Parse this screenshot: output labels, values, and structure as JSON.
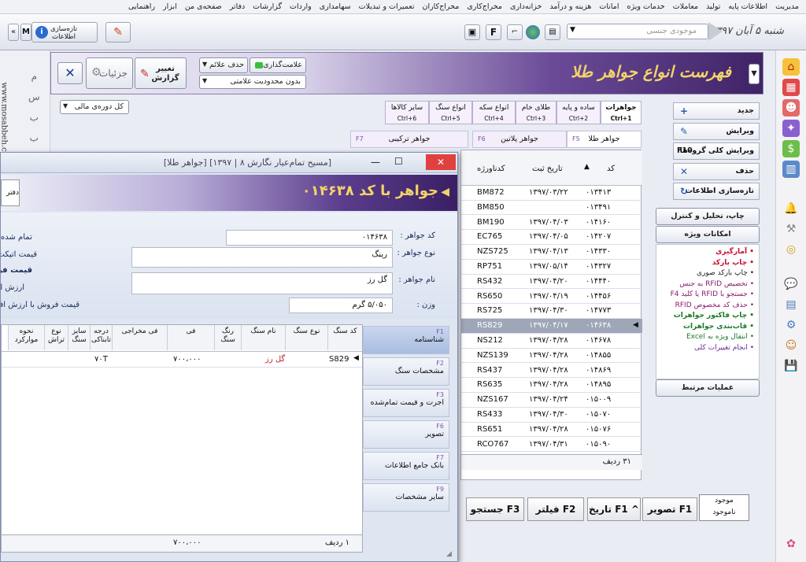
{
  "menubar": [
    "مدیریت",
    "اطلاعات پایه",
    "تولید",
    "معاملات",
    "خدمات ویژه",
    "امانات",
    "هزینه و درآمد",
    "خزانه‌داری",
    "مخراج‌کاری",
    "مخراج‌کاران",
    "تعمیرات و تبدیلات",
    "سهامداری",
    "واردات",
    "گزارشات",
    "دفاتر",
    "صفحه‌ی من",
    "ابزار",
    "راهنمایی"
  ],
  "toolbar": {
    "date": "شنبه ۵ آبان ۱۳۹۷",
    "gender_placeholder": "موجودی جنسی",
    "refresh_label": "تازه‌سازی اطلاعات",
    "m_label": "M"
  },
  "banner": {
    "title": "فهرست انواع جواهر طلا",
    "marking_label": "علامت‌گذاری",
    "remove_marks_label": "حذف علائم",
    "no_limit_label": "بدون محدودیت علامتی",
    "change_report_label": "تغییر گزارش",
    "details_label": "جزئیات"
  },
  "fiscal": "کل دوره‌ی مالی",
  "actions": [
    "جدید",
    "ویرایش",
    "ویرایش کلی گروه‌ها",
    "حذف",
    "تازه‌سازی اطلاعات"
  ],
  "actions_f10": "F10",
  "print_label": "چاپ، تحلیل و کنترل فهرست",
  "special_label": "امکانات ویژه",
  "options": [
    {
      "t": "آمارگیری",
      "c": "#c8102e",
      "b": true
    },
    {
      "t": "چاپ بارکد",
      "c": "#c8102e",
      "b": true
    },
    {
      "t": "چاپ بارکد صوری",
      "c": "#222",
      "b": false
    },
    {
      "t": "تخصیص RFID به جنس",
      "c": "#8b1a6b",
      "b": false
    },
    {
      "t": "جستجو با RFID یا کلید F4",
      "c": "#8b1a6b",
      "b": false
    },
    {
      "t": "حذف کد مخصوص RFID",
      "c": "#8b1a6b",
      "b": false
    },
    {
      "t": "چاپ فاکتور جواهرات",
      "c": "#1a7a2a",
      "b": true
    },
    {
      "t": "قاب‌بندی جواهرات",
      "c": "#1a7a2a",
      "b": true
    },
    {
      "t": "انتقال ویژه به Excel",
      "c": "#1a7a2a",
      "b": false
    },
    {
      "t": "انجام تغییرات کلی",
      "c": "#6a2a9a",
      "b": false
    }
  ],
  "related_label": "عملیات مرتبط",
  "tabs1": [
    {
      "label": "جواهرات",
      "key": "Ctrl+1"
    },
    {
      "label": "ساده و پایه",
      "key": "Ctrl+2"
    },
    {
      "label": "طلای خام",
      "key": "Ctrl+3"
    },
    {
      "label": "انواع سکه",
      "key": "Ctrl+4"
    },
    {
      "label": "انواع سنگ",
      "key": "Ctrl+5"
    },
    {
      "label": "سایر کالاها",
      "key": "Ctrl+6"
    }
  ],
  "tabs2": [
    {
      "label": "جواهر طلا",
      "key": "F5"
    },
    {
      "label": "جواهر پلاتین",
      "key": "F6"
    },
    {
      "label": "جواهر ترکیبی",
      "key": "F7"
    }
  ],
  "grid": {
    "headers": [
      "کد",
      "تاریخ ثبت",
      "کدناورژه"
    ],
    "rows": [
      [
        "۰۱۳۴۱۳",
        "۱۳۹۷/۰۳/۲۲",
        "BM872"
      ],
      [
        "۰۱۳۴۹۱",
        "",
        "BM850"
      ],
      [
        "۰۱۴۱۶۰",
        "۱۳۹۷/۰۴/۰۳",
        "BM190"
      ],
      [
        "۰۱۴۲۰۷",
        "۱۳۹۷/۰۴/۰۵",
        "EC765"
      ],
      [
        "۰۱۴۳۳۰",
        "۱۳۹۷/۰۴/۱۳",
        "NZS725"
      ],
      [
        "۰۱۴۳۲۷",
        "۱۳۹۷/۰۵/۱۴",
        "RP751"
      ],
      [
        "۰۱۴۴۴۰",
        "۱۳۹۷/۰۴/۲۰",
        "RS432"
      ],
      [
        "۰۱۴۴۵۶",
        "۱۳۹۷/۰۴/۱۹",
        "RS650"
      ],
      [
        "۰۱۴۷۷۳",
        "۱۳۹۷/۰۴/۳۰",
        "RS725"
      ],
      [
        "۰۱۴۶۳۸",
        "۱۳۹۷/۰۴/۱۷",
        "RS829"
      ],
      [
        "۰۱۴۶۷۸",
        "۱۳۹۷/۰۴/۲۸",
        "NS212"
      ],
      [
        "۰۱۴۸۵۵",
        "۱۳۹۷/۰۴/۲۸",
        "NZS139"
      ],
      [
        "۰۱۴۸۶۹",
        "۱۳۹۷/۰۴/۲۸",
        "RS437"
      ],
      [
        "۰۱۴۸۹۵",
        "۱۳۹۷/۰۴/۲۸",
        "RS635"
      ],
      [
        "۰۱۵۰۰۹",
        "۱۳۹۷/۰۴/۲۴",
        "NZS167"
      ],
      [
        "۰۱۵۰۷۰",
        "۱۳۹۷/۰۴/۳۰",
        "RS433"
      ],
      [
        "۰۱۵۰۷۶",
        "۱۳۹۷/۰۴/۲۸",
        "RS651"
      ],
      [
        "۰۱۵۰۹۰",
        "۱۳۹۷/۰۴/۳۱",
        "RCO767"
      ]
    ],
    "footer": "۳۱ ردیف"
  },
  "footbtns": [
    {
      "label": "تصویر",
      "key": "F1"
    },
    {
      "label": "تاریخ",
      "key": "F1 ^"
    },
    {
      "label": "فیلتر",
      "key": "F2"
    },
    {
      "label": "جستجو",
      "key": "F3"
    }
  ],
  "stock": [
    "موجود",
    "ناموجود"
  ],
  "dialog": {
    "title": "[مسیح تمام‌عیار نگارش ۸ | ۱۳۹۷] [جواهر طلا]",
    "banner": "جواهر با کد ۰۱۴۶۳۸",
    "office_label": "دفتر حساب",
    "fields": {
      "code_label": "کد جواهر :",
      "code_value": "۰۱۴۶۳۸",
      "type_label": "نوع جواهر :",
      "type_value": "رینگ",
      "name_label": "نام جواهر :",
      "name_value": "گل رز",
      "weight_label": "وزن :",
      "weight_value": "۵/۰۵۰ گرم"
    },
    "right_labels": [
      "قیمت تمام شده",
      "قیمت اتیکت",
      "قیمت فروش",
      "ارزش افزوده",
      "قیمت فروش با ارزش افزوده"
    ],
    "stone_headers": [
      "کد سنگ",
      "نوع سنگ",
      "نام سنگ",
      "رنگ سنگ",
      "فی",
      "فی مخراجی",
      "درجه تابناکی",
      "سایز سنگ",
      "نوع تراش",
      "نحوه موارکرد"
    ],
    "stone_row": {
      "code": "S829",
      "name": "گل رز",
      "fee": "۷۰۰،۰۰۰",
      "grade": "۷۰T"
    },
    "stone_footer": {
      "count": "۱ ردیف",
      "total": "۷۰۰،۰۰۰"
    },
    "side_tabs": [
      {
        "key": "F1",
        "label": "شناسنامه"
      },
      {
        "key": "F2",
        "label": "مشخصات سنگ"
      },
      {
        "key": "F3",
        "label": "اجرت و قیمت تمام‌شده"
      },
      {
        "key": "F6",
        "label": "تصویر"
      },
      {
        "key": "F7",
        "label": "بانک جامع اطلاعات"
      },
      {
        "key": "F9",
        "label": "سایر مشخصات"
      }
    ]
  },
  "left_strip_text": "www.mosabbeh.com"
}
